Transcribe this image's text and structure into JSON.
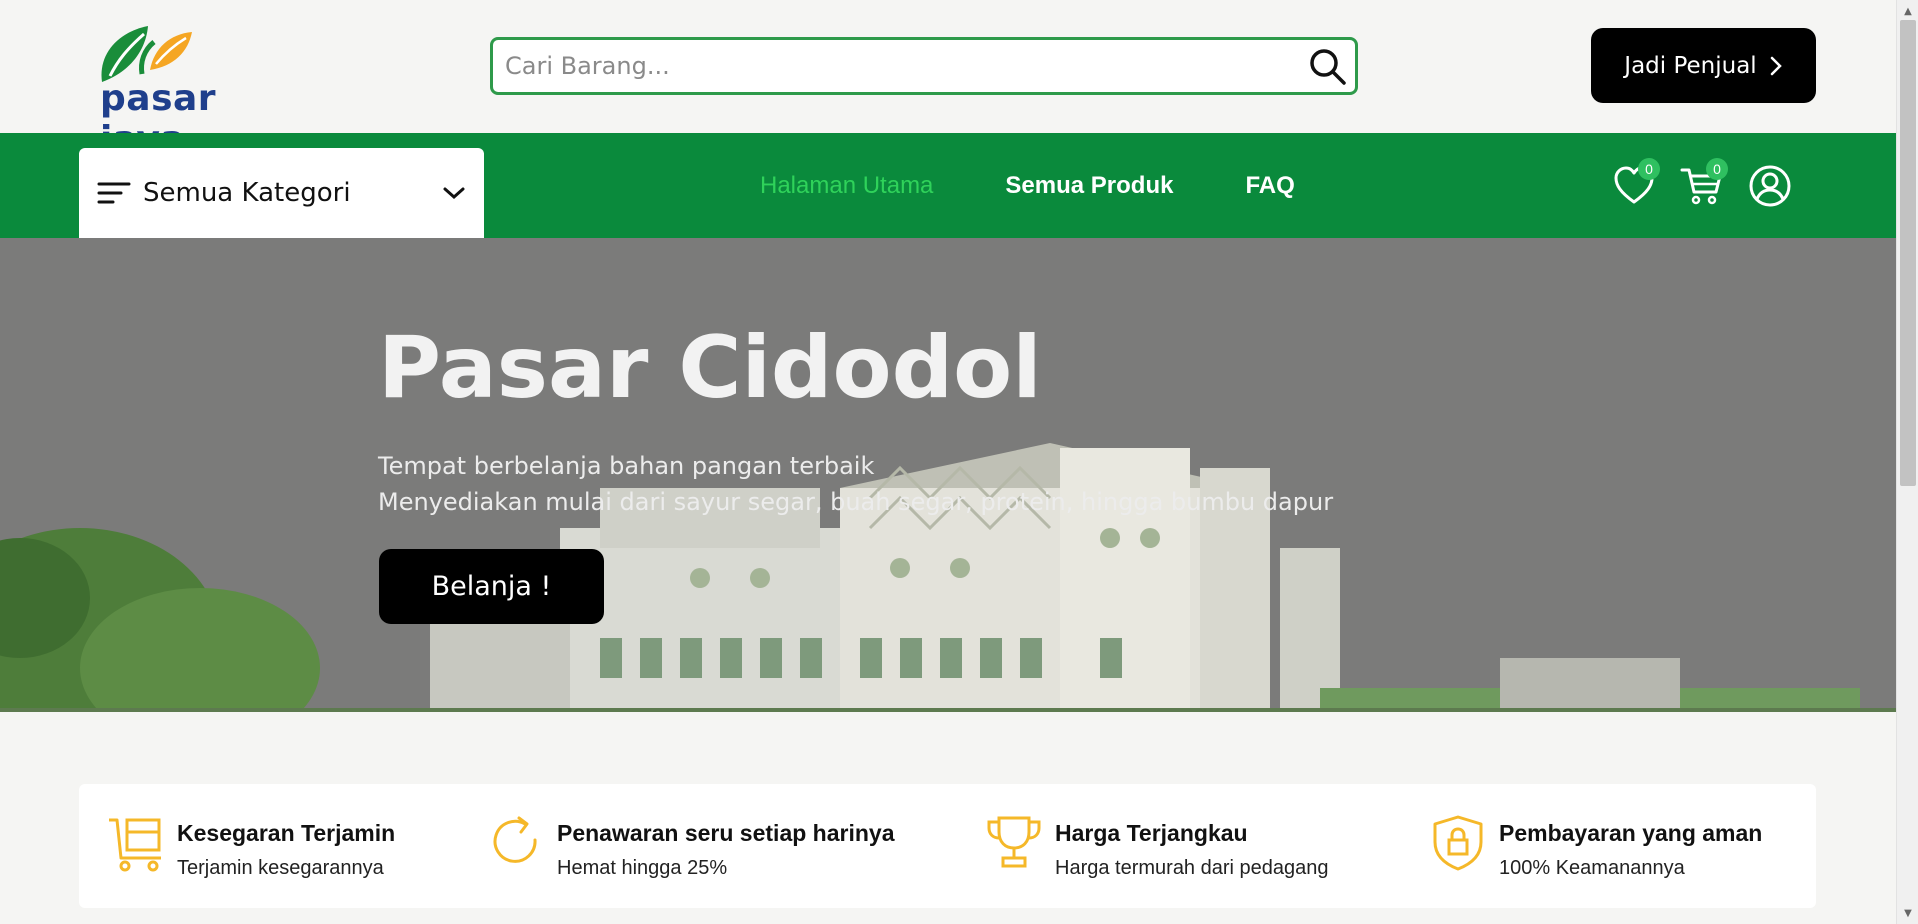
{
  "header": {
    "logo_text": "pasar jaya",
    "search_placeholder": "Cari Barang...",
    "seller_button": "Jadi Penjual"
  },
  "nav": {
    "category_label": "Semua Kategori",
    "links": [
      {
        "label": "Halaman Utama",
        "active": true
      },
      {
        "label": "Semua Produk",
        "active": false
      },
      {
        "label": "FAQ",
        "active": false
      }
    ],
    "wishlist_count": "0",
    "cart_count": "0"
  },
  "hero": {
    "title": "Pasar Cidodol",
    "line1": "Tempat berbelanja bahan pangan terbaik",
    "line2": "Menyediakan mulai dari sayur segar, buah segar, protein, hingga bumbu dapur",
    "button": "Belanja !"
  },
  "features": [
    {
      "icon": "shelf-cart-icon",
      "title": "Kesegaran Terjamin",
      "desc": "Terjamin kesegarannya"
    },
    {
      "icon": "refresh-icon",
      "title": "Penawaran seru setiap harinya",
      "desc": "Hemat hingga 25%"
    },
    {
      "icon": "trophy-icon",
      "title": "Harga Terjangkau",
      "desc": "Harga termurah dari pedagang"
    },
    {
      "icon": "shield-lock-icon",
      "title": "Pembayaran yang aman",
      "desc": "100% Keamanannya"
    }
  ],
  "colors": {
    "brand_green": "#0a8a3c",
    "active_link": "#2fd25a",
    "feature_icon": "#f5b829",
    "logo_blue": "#1f3f8c"
  }
}
